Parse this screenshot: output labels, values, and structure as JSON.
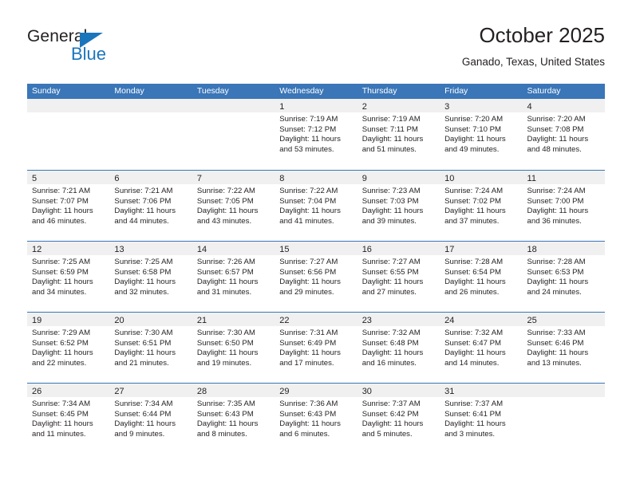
{
  "brand": {
    "name_part1": "General",
    "name_part2": "Blue",
    "accent_color": "#1b75bb"
  },
  "header": {
    "month_title": "October 2025",
    "location": "Ganado, Texas, United States"
  },
  "theme": {
    "header_blue": "#3a76b8",
    "day_head_gray": "#f0f0f0"
  },
  "weekday_headers": [
    "Sunday",
    "Monday",
    "Tuesday",
    "Wednesday",
    "Thursday",
    "Friday",
    "Saturday"
  ],
  "weeks": [
    [
      {
        "day": "",
        "empty": true
      },
      {
        "day": "",
        "empty": true
      },
      {
        "day": "",
        "empty": true
      },
      {
        "day": "1",
        "sunrise": "Sunrise: 7:19 AM",
        "sunset": "Sunset: 7:12 PM",
        "daylight": "Daylight: 11 hours and 53 minutes."
      },
      {
        "day": "2",
        "sunrise": "Sunrise: 7:19 AM",
        "sunset": "Sunset: 7:11 PM",
        "daylight": "Daylight: 11 hours and 51 minutes."
      },
      {
        "day": "3",
        "sunrise": "Sunrise: 7:20 AM",
        "sunset": "Sunset: 7:10 PM",
        "daylight": "Daylight: 11 hours and 49 minutes."
      },
      {
        "day": "4",
        "sunrise": "Sunrise: 7:20 AM",
        "sunset": "Sunset: 7:08 PM",
        "daylight": "Daylight: 11 hours and 48 minutes."
      }
    ],
    [
      {
        "day": "5",
        "sunrise": "Sunrise: 7:21 AM",
        "sunset": "Sunset: 7:07 PM",
        "daylight": "Daylight: 11 hours and 46 minutes."
      },
      {
        "day": "6",
        "sunrise": "Sunrise: 7:21 AM",
        "sunset": "Sunset: 7:06 PM",
        "daylight": "Daylight: 11 hours and 44 minutes."
      },
      {
        "day": "7",
        "sunrise": "Sunrise: 7:22 AM",
        "sunset": "Sunset: 7:05 PM",
        "daylight": "Daylight: 11 hours and 43 minutes."
      },
      {
        "day": "8",
        "sunrise": "Sunrise: 7:22 AM",
        "sunset": "Sunset: 7:04 PM",
        "daylight": "Daylight: 11 hours and 41 minutes."
      },
      {
        "day": "9",
        "sunrise": "Sunrise: 7:23 AM",
        "sunset": "Sunset: 7:03 PM",
        "daylight": "Daylight: 11 hours and 39 minutes."
      },
      {
        "day": "10",
        "sunrise": "Sunrise: 7:24 AM",
        "sunset": "Sunset: 7:02 PM",
        "daylight": "Daylight: 11 hours and 37 minutes."
      },
      {
        "day": "11",
        "sunrise": "Sunrise: 7:24 AM",
        "sunset": "Sunset: 7:00 PM",
        "daylight": "Daylight: 11 hours and 36 minutes."
      }
    ],
    [
      {
        "day": "12",
        "sunrise": "Sunrise: 7:25 AM",
        "sunset": "Sunset: 6:59 PM",
        "daylight": "Daylight: 11 hours and 34 minutes."
      },
      {
        "day": "13",
        "sunrise": "Sunrise: 7:25 AM",
        "sunset": "Sunset: 6:58 PM",
        "daylight": "Daylight: 11 hours and 32 minutes."
      },
      {
        "day": "14",
        "sunrise": "Sunrise: 7:26 AM",
        "sunset": "Sunset: 6:57 PM",
        "daylight": "Daylight: 11 hours and 31 minutes."
      },
      {
        "day": "15",
        "sunrise": "Sunrise: 7:27 AM",
        "sunset": "Sunset: 6:56 PM",
        "daylight": "Daylight: 11 hours and 29 minutes."
      },
      {
        "day": "16",
        "sunrise": "Sunrise: 7:27 AM",
        "sunset": "Sunset: 6:55 PM",
        "daylight": "Daylight: 11 hours and 27 minutes."
      },
      {
        "day": "17",
        "sunrise": "Sunrise: 7:28 AM",
        "sunset": "Sunset: 6:54 PM",
        "daylight": "Daylight: 11 hours and 26 minutes."
      },
      {
        "day": "18",
        "sunrise": "Sunrise: 7:28 AM",
        "sunset": "Sunset: 6:53 PM",
        "daylight": "Daylight: 11 hours and 24 minutes."
      }
    ],
    [
      {
        "day": "19",
        "sunrise": "Sunrise: 7:29 AM",
        "sunset": "Sunset: 6:52 PM",
        "daylight": "Daylight: 11 hours and 22 minutes."
      },
      {
        "day": "20",
        "sunrise": "Sunrise: 7:30 AM",
        "sunset": "Sunset: 6:51 PM",
        "daylight": "Daylight: 11 hours and 21 minutes."
      },
      {
        "day": "21",
        "sunrise": "Sunrise: 7:30 AM",
        "sunset": "Sunset: 6:50 PM",
        "daylight": "Daylight: 11 hours and 19 minutes."
      },
      {
        "day": "22",
        "sunrise": "Sunrise: 7:31 AM",
        "sunset": "Sunset: 6:49 PM",
        "daylight": "Daylight: 11 hours and 17 minutes."
      },
      {
        "day": "23",
        "sunrise": "Sunrise: 7:32 AM",
        "sunset": "Sunset: 6:48 PM",
        "daylight": "Daylight: 11 hours and 16 minutes."
      },
      {
        "day": "24",
        "sunrise": "Sunrise: 7:32 AM",
        "sunset": "Sunset: 6:47 PM",
        "daylight": "Daylight: 11 hours and 14 minutes."
      },
      {
        "day": "25",
        "sunrise": "Sunrise: 7:33 AM",
        "sunset": "Sunset: 6:46 PM",
        "daylight": "Daylight: 11 hours and 13 minutes."
      }
    ],
    [
      {
        "day": "26",
        "sunrise": "Sunrise: 7:34 AM",
        "sunset": "Sunset: 6:45 PM",
        "daylight": "Daylight: 11 hours and 11 minutes."
      },
      {
        "day": "27",
        "sunrise": "Sunrise: 7:34 AM",
        "sunset": "Sunset: 6:44 PM",
        "daylight": "Daylight: 11 hours and 9 minutes."
      },
      {
        "day": "28",
        "sunrise": "Sunrise: 7:35 AM",
        "sunset": "Sunset: 6:43 PM",
        "daylight": "Daylight: 11 hours and 8 minutes."
      },
      {
        "day": "29",
        "sunrise": "Sunrise: 7:36 AM",
        "sunset": "Sunset: 6:43 PM",
        "daylight": "Daylight: 11 hours and 6 minutes."
      },
      {
        "day": "30",
        "sunrise": "Sunrise: 7:37 AM",
        "sunset": "Sunset: 6:42 PM",
        "daylight": "Daylight: 11 hours and 5 minutes."
      },
      {
        "day": "31",
        "sunrise": "Sunrise: 7:37 AM",
        "sunset": "Sunset: 6:41 PM",
        "daylight": "Daylight: 11 hours and 3 minutes."
      },
      {
        "day": "",
        "empty": true
      }
    ]
  ]
}
